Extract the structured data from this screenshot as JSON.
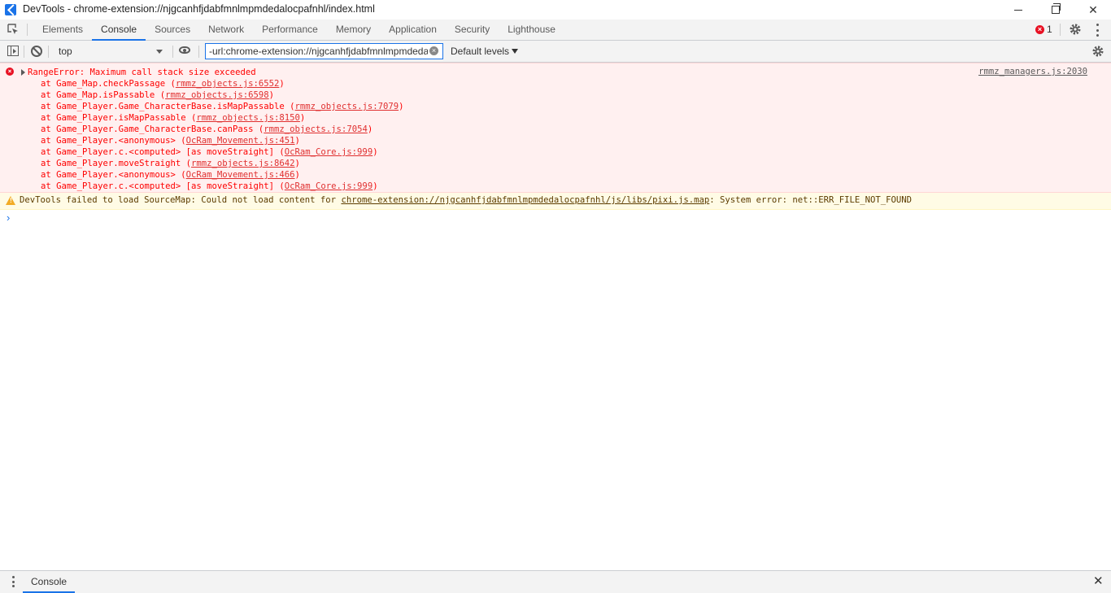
{
  "window": {
    "title": "DevTools - chrome-extension://njgcanhfjdabfmnlmpmdedalocpafnhl/index.html",
    "close_glyph": "✕"
  },
  "tabs": [
    "Elements",
    "Console",
    "Sources",
    "Network",
    "Performance",
    "Memory",
    "Application",
    "Security",
    "Lighthouse"
  ],
  "active_tab": "Console",
  "error_count": "1",
  "toolbar": {
    "context": "top",
    "filter_value": "-url:chrome-extension://njgcanhfjdabfmnlmpmdedalocpafnhl",
    "levels": "Default levels"
  },
  "error": {
    "message": "RangeError: Maximum call stack size exceeded",
    "source": "rmmz_managers.js:2030",
    "stack": [
      {
        "prefix": "at Game_Map.checkPassage (",
        "link": "rmmz_objects.js:6552",
        "suffix": ")"
      },
      {
        "prefix": "at Game_Map.isPassable (",
        "link": "rmmz_objects.js:6598",
        "suffix": ")"
      },
      {
        "prefix": "at Game_Player.Game_CharacterBase.isMapPassable (",
        "link": "rmmz_objects.js:7079",
        "suffix": ")"
      },
      {
        "prefix": "at Game_Player.isMapPassable (",
        "link": "rmmz_objects.js:8150",
        "suffix": ")"
      },
      {
        "prefix": "at Game_Player.Game_CharacterBase.canPass (",
        "link": "rmmz_objects.js:7054",
        "suffix": ")"
      },
      {
        "prefix": "at Game_Player.<anonymous> (",
        "link": "OcRam_Movement.js:451",
        "suffix": ")"
      },
      {
        "prefix": "at Game_Player.c.<computed> [as moveStraight] (",
        "link": "OcRam_Core.js:999",
        "suffix": ")"
      },
      {
        "prefix": "at Game_Player.moveStraight (",
        "link": "rmmz_objects.js:8642",
        "suffix": ")"
      },
      {
        "prefix": "at Game_Player.<anonymous> (",
        "link": "OcRam_Movement.js:466",
        "suffix": ")"
      },
      {
        "prefix": "at Game_Player.c.<computed> [as moveStraight] (",
        "link": "OcRam_Core.js:999",
        "suffix": ")"
      }
    ]
  },
  "warning": {
    "prefix": "DevTools failed to load SourceMap: Could not load content for ",
    "link": "chrome-extension://njgcanhfjdabfmnlmpmdedalocpafnhl/js/libs/pixi.js.map",
    "suffix": ": System error: net::ERR_FILE_NOT_FOUND"
  },
  "prompt_glyph": "›",
  "drawer": {
    "tab": "Console",
    "close_glyph": "✕"
  },
  "colors": {
    "accent": "#1a73e8",
    "error_text": "#fe0000",
    "error_bg": "#fff0f0",
    "warning_bg": "#fffbe5",
    "warning_text": "#5c3c00"
  }
}
